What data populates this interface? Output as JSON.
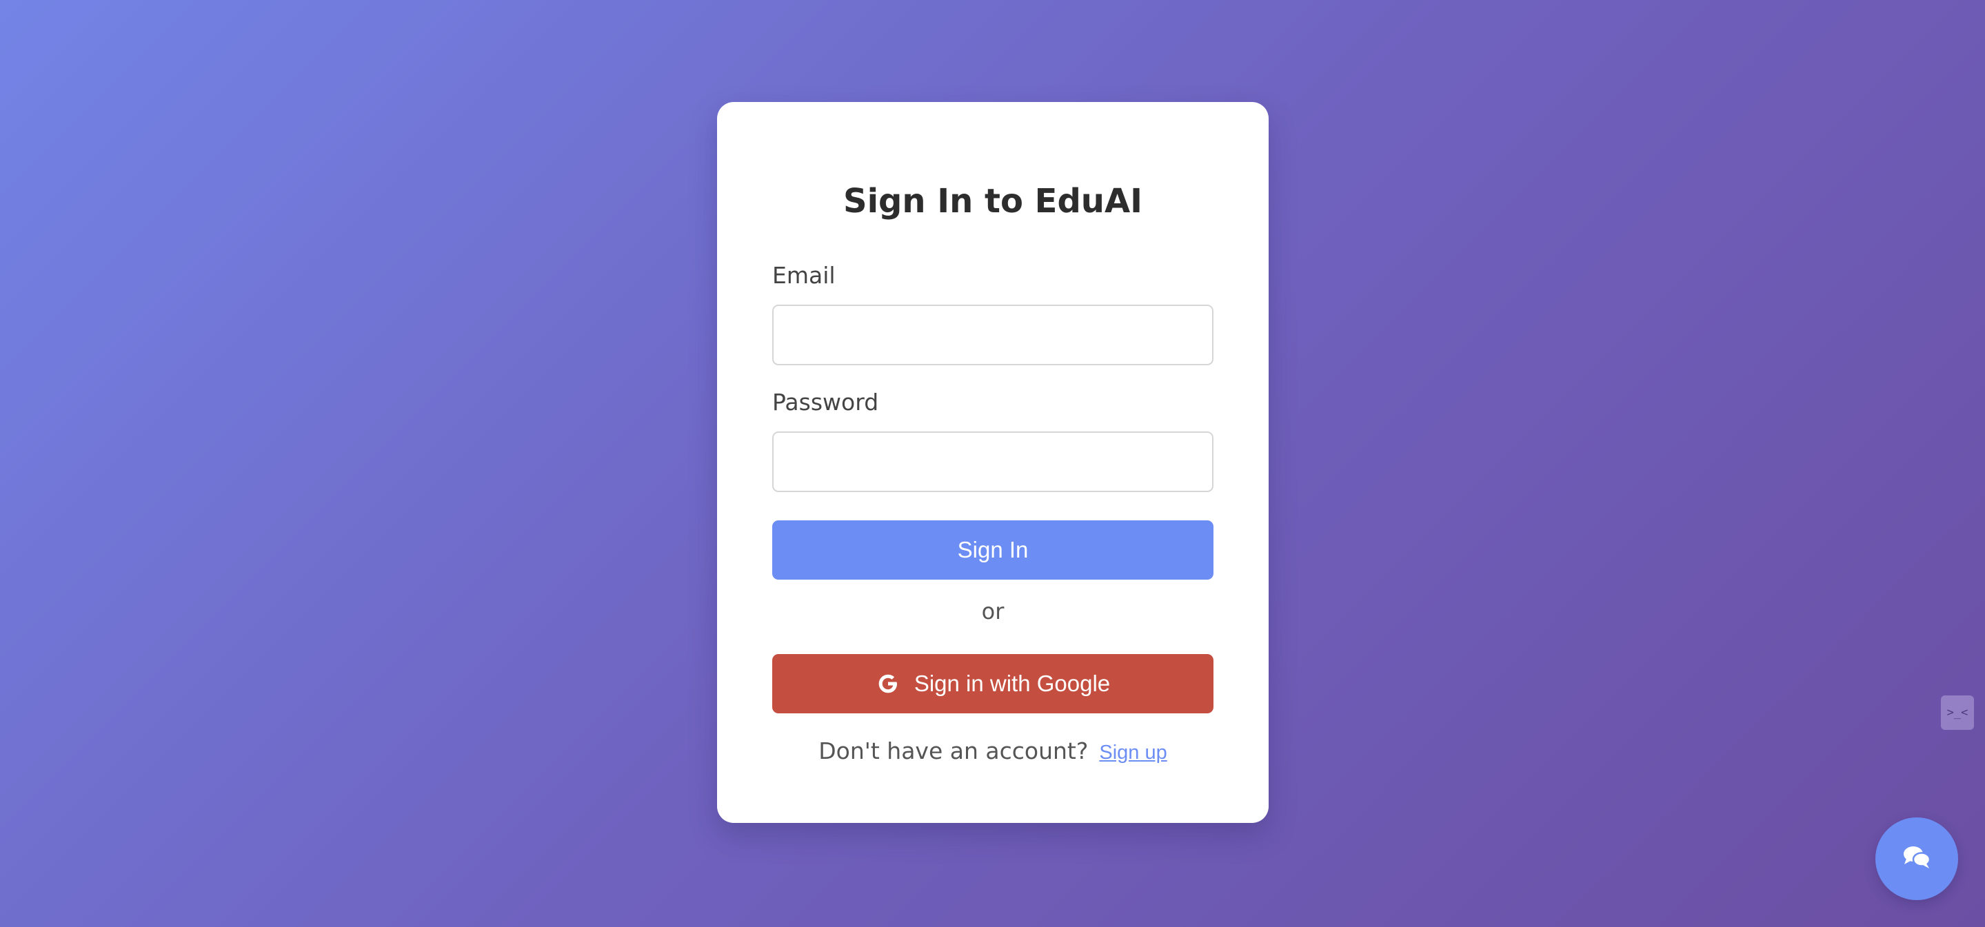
{
  "form": {
    "title": "Sign In to EduAI",
    "email_label": "Email",
    "email_value": "",
    "email_placeholder": "",
    "password_label": "Password",
    "password_value": "",
    "password_placeholder": "",
    "signin_button": "Sign In",
    "divider_text": "or",
    "google_button": "Sign in with Google",
    "footer_text": "Don't have an account?",
    "signup_link": "Sign up"
  },
  "widgets": {
    "side_widget_text": ">_<",
    "chat_icon": "chat-bubbles-icon",
    "google_icon": "google-icon"
  },
  "colors": {
    "background_start": "#7384e6",
    "background_end": "#6b4fa3",
    "primary": "#6c8ef4",
    "google": "#c44f40"
  }
}
